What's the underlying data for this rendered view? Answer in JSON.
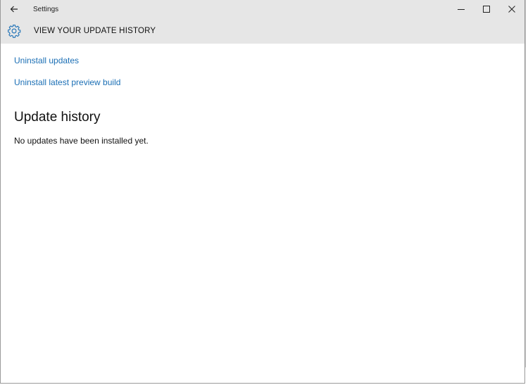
{
  "titlebar": {
    "title": "Settings",
    "back_icon": "arrow-left-icon",
    "minimize_icon": "minimize-icon",
    "maximize_icon": "maximize-icon",
    "close_icon": "close-icon"
  },
  "header": {
    "icon": "gear-icon",
    "title": "VIEW YOUR UPDATE HISTORY"
  },
  "links": [
    {
      "label": "Uninstall updates"
    },
    {
      "label": "Uninstall latest preview build"
    }
  ],
  "history": {
    "title": "Update history",
    "status": "No updates have been installed yet."
  },
  "colors": {
    "accent": "#1b6fb5",
    "header_bg": "#e6e6e6"
  }
}
